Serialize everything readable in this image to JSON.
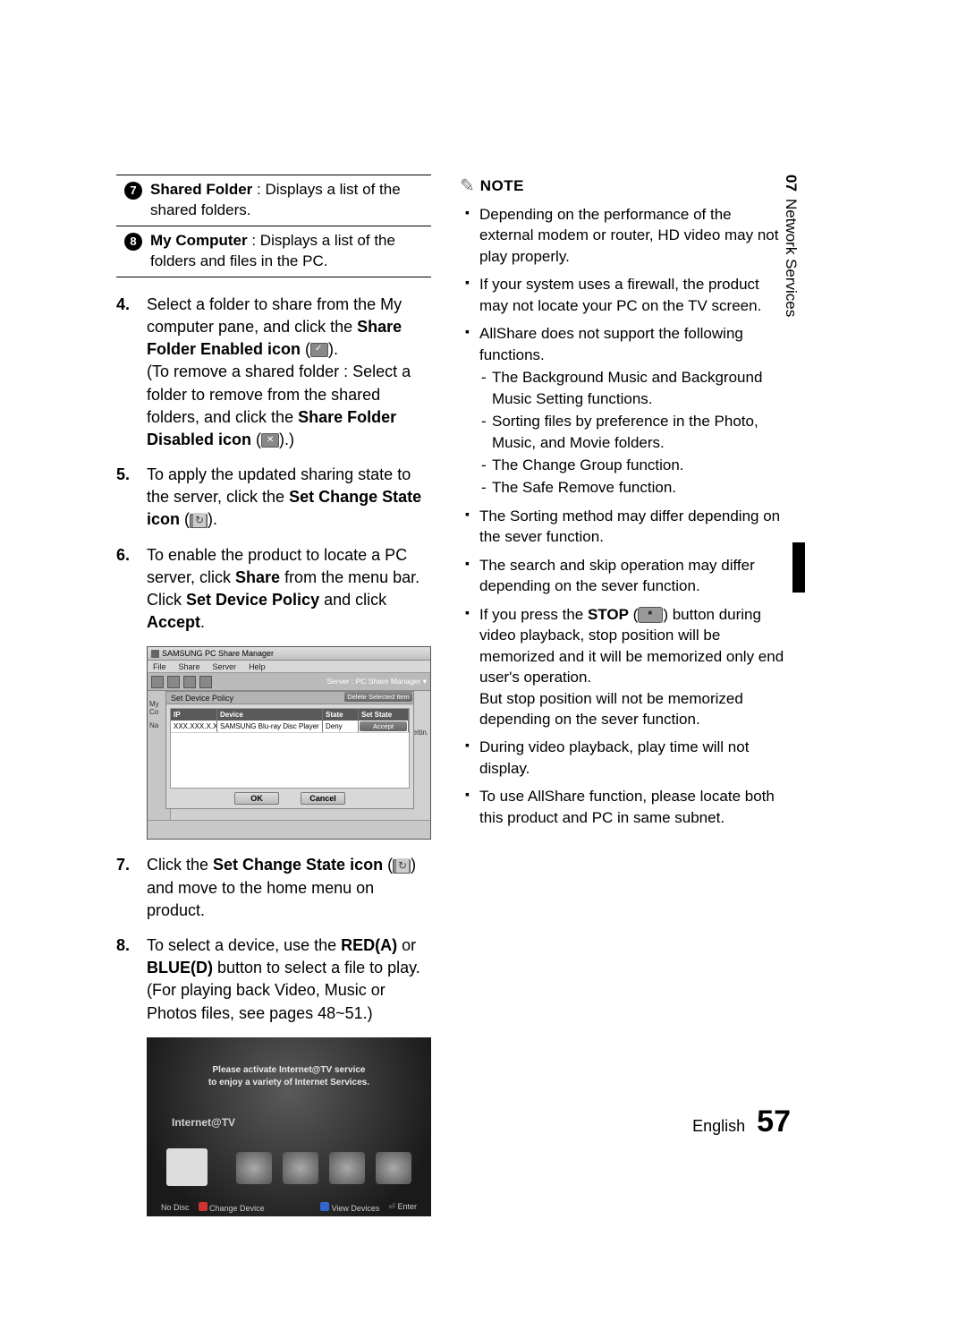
{
  "side_tab": {
    "chapter": "07",
    "title": "Network Services"
  },
  "footer": {
    "lang": "English",
    "page": "57"
  },
  "definitions": [
    {
      "num": "7",
      "term": "Shared Folder",
      "desc": " : Displays a list of the shared folders."
    },
    {
      "num": "8",
      "term": "My Computer",
      "desc": " : Displays a list of the folders and files in the PC."
    }
  ],
  "steps": {
    "s4": {
      "num": "4.",
      "line1": "Select a folder to share from the My computer pane, and click the ",
      "bold1": "Share Folder Enabled icon",
      "after_bold1": " (",
      "after_icon1": ").",
      "line2a": "(To remove a shared folder : Select a folder to remove from the shared folders, and click the ",
      "bold2": "Share Folder Disabled icon",
      "after_bold2": " (",
      "after_icon2": ").)"
    },
    "s5": {
      "num": "5.",
      "line": "To apply the updated sharing state to the server, click the ",
      "bold": "Set Change State icon",
      "after_bold": " (",
      "after_icon": ")."
    },
    "s6": {
      "num": "6.",
      "line1": "To enable the product to locate a PC server, click ",
      "bold1": "Share",
      "after1": " from the menu bar.",
      "line2a": "Click ",
      "bold2": "Set Device Policy",
      "mid2": " and click ",
      "bold3": "Accept",
      "after2": "."
    },
    "s7": {
      "num": "7.",
      "a": "Click the ",
      "bold": "Set Change State icon",
      "b": " (",
      "c": ") and move to the home menu on product."
    },
    "s8": {
      "num": "8.",
      "a": "To select a device, use the ",
      "bold1": "RED(A)",
      "mid": " or ",
      "bold2": "BLUE(D)",
      "b": " button to select a file to play.",
      "c": "(For playing back Video, Music or Photos files, see pages 48~51.)"
    }
  },
  "dialog": {
    "title": "SAMSUNG PC Share Manager",
    "menu": [
      "File",
      "Share",
      "Server",
      "Help"
    ],
    "server_label": "Server : PC Share Manager ▾",
    "panel_title": "Set Device Policy",
    "delete_btn": "Delete Selected Item",
    "headers": {
      "ip": "IP",
      "device": "Device",
      "state": "State",
      "set": "Set State"
    },
    "row": {
      "ip": "XXX.XXX.X.XX",
      "device": "SAMSUNG Blu-ray Disc Player",
      "state": "Deny",
      "set": "Accept"
    },
    "ok": "OK",
    "cancel": "Cancel",
    "side_my": "My Co",
    "side_na": "Na",
    "side_rt": "ettin."
  },
  "product": {
    "msg1": "Please activate Internet@TV service",
    "msg2": "to enjoy a variety of Internet Services.",
    "logo": "Internet@TV",
    "nodisc": "No Disc",
    "change": "Change Device",
    "view": "View Devices",
    "enter": "Enter"
  },
  "note": {
    "label": "NOTE",
    "items": {
      "i1": "Depending on the performance of the external modem or router, HD video may not play properly.",
      "i2": "If your system uses a firewall, the product may not locate your PC on the TV screen.",
      "i3": "AllShare does not support the following functions.",
      "i3s1": "The Background Music and Background Music Setting functions.",
      "i3s2": "Sorting files by preference in the Photo, Music, and Movie folders.",
      "i3s3": "The Change Group function.",
      "i3s4": "The Safe Remove function.",
      "i4": "The Sorting method may differ depending on the sever function.",
      "i5": "The search and skip operation may differ depending on the sever function.",
      "i6a": "If you press the ",
      "i6bold": "STOP",
      "i6b": " (",
      "i6c": ") button during video playback, stop position will be memorized and it will be memorized only end user's operation.",
      "i6d": "But stop position will not be memorized depending on the sever function.",
      "i7": "During video playback, play time will not display.",
      "i8": "To use AllShare function, please locate both this product and PC in same subnet."
    }
  }
}
